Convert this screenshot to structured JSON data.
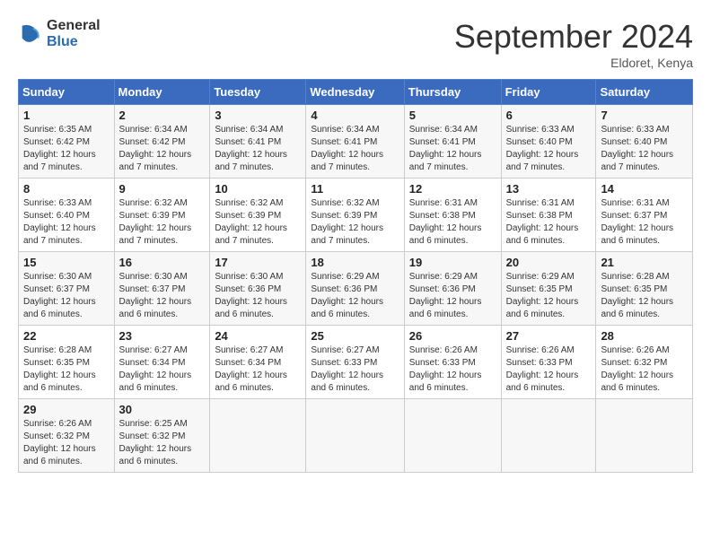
{
  "logo": {
    "general": "General",
    "blue": "Blue"
  },
  "title": "September 2024",
  "location": "Eldoret, Kenya",
  "days_of_week": [
    "Sunday",
    "Monday",
    "Tuesday",
    "Wednesday",
    "Thursday",
    "Friday",
    "Saturday"
  ],
  "weeks": [
    [
      {
        "day": "1",
        "sunrise": "6:35 AM",
        "sunset": "6:42 PM",
        "daylight": "12 hours and 7 minutes."
      },
      {
        "day": "2",
        "sunrise": "6:34 AM",
        "sunset": "6:42 PM",
        "daylight": "12 hours and 7 minutes."
      },
      {
        "day": "3",
        "sunrise": "6:34 AM",
        "sunset": "6:41 PM",
        "daylight": "12 hours and 7 minutes."
      },
      {
        "day": "4",
        "sunrise": "6:34 AM",
        "sunset": "6:41 PM",
        "daylight": "12 hours and 7 minutes."
      },
      {
        "day": "5",
        "sunrise": "6:34 AM",
        "sunset": "6:41 PM",
        "daylight": "12 hours and 7 minutes."
      },
      {
        "day": "6",
        "sunrise": "6:33 AM",
        "sunset": "6:40 PM",
        "daylight": "12 hours and 7 minutes."
      },
      {
        "day": "7",
        "sunrise": "6:33 AM",
        "sunset": "6:40 PM",
        "daylight": "12 hours and 7 minutes."
      }
    ],
    [
      {
        "day": "8",
        "sunrise": "6:33 AM",
        "sunset": "6:40 PM",
        "daylight": "12 hours and 7 minutes."
      },
      {
        "day": "9",
        "sunrise": "6:32 AM",
        "sunset": "6:39 PM",
        "daylight": "12 hours and 7 minutes."
      },
      {
        "day": "10",
        "sunrise": "6:32 AM",
        "sunset": "6:39 PM",
        "daylight": "12 hours and 7 minutes."
      },
      {
        "day": "11",
        "sunrise": "6:32 AM",
        "sunset": "6:39 PM",
        "daylight": "12 hours and 7 minutes."
      },
      {
        "day": "12",
        "sunrise": "6:31 AM",
        "sunset": "6:38 PM",
        "daylight": "12 hours and 6 minutes."
      },
      {
        "day": "13",
        "sunrise": "6:31 AM",
        "sunset": "6:38 PM",
        "daylight": "12 hours and 6 minutes."
      },
      {
        "day": "14",
        "sunrise": "6:31 AM",
        "sunset": "6:37 PM",
        "daylight": "12 hours and 6 minutes."
      }
    ],
    [
      {
        "day": "15",
        "sunrise": "6:30 AM",
        "sunset": "6:37 PM",
        "daylight": "12 hours and 6 minutes."
      },
      {
        "day": "16",
        "sunrise": "6:30 AM",
        "sunset": "6:37 PM",
        "daylight": "12 hours and 6 minutes."
      },
      {
        "day": "17",
        "sunrise": "6:30 AM",
        "sunset": "6:36 PM",
        "daylight": "12 hours and 6 minutes."
      },
      {
        "day": "18",
        "sunrise": "6:29 AM",
        "sunset": "6:36 PM",
        "daylight": "12 hours and 6 minutes."
      },
      {
        "day": "19",
        "sunrise": "6:29 AM",
        "sunset": "6:36 PM",
        "daylight": "12 hours and 6 minutes."
      },
      {
        "day": "20",
        "sunrise": "6:29 AM",
        "sunset": "6:35 PM",
        "daylight": "12 hours and 6 minutes."
      },
      {
        "day": "21",
        "sunrise": "6:28 AM",
        "sunset": "6:35 PM",
        "daylight": "12 hours and 6 minutes."
      }
    ],
    [
      {
        "day": "22",
        "sunrise": "6:28 AM",
        "sunset": "6:35 PM",
        "daylight": "12 hours and 6 minutes."
      },
      {
        "day": "23",
        "sunrise": "6:27 AM",
        "sunset": "6:34 PM",
        "daylight": "12 hours and 6 minutes."
      },
      {
        "day": "24",
        "sunrise": "6:27 AM",
        "sunset": "6:34 PM",
        "daylight": "12 hours and 6 minutes."
      },
      {
        "day": "25",
        "sunrise": "6:27 AM",
        "sunset": "6:33 PM",
        "daylight": "12 hours and 6 minutes."
      },
      {
        "day": "26",
        "sunrise": "6:26 AM",
        "sunset": "6:33 PM",
        "daylight": "12 hours and 6 minutes."
      },
      {
        "day": "27",
        "sunrise": "6:26 AM",
        "sunset": "6:33 PM",
        "daylight": "12 hours and 6 minutes."
      },
      {
        "day": "28",
        "sunrise": "6:26 AM",
        "sunset": "6:32 PM",
        "daylight": "12 hours and 6 minutes."
      }
    ],
    [
      {
        "day": "29",
        "sunrise": "6:26 AM",
        "sunset": "6:32 PM",
        "daylight": "12 hours and 6 minutes."
      },
      {
        "day": "30",
        "sunrise": "6:25 AM",
        "sunset": "6:32 PM",
        "daylight": "12 hours and 6 minutes."
      },
      null,
      null,
      null,
      null,
      null
    ]
  ],
  "labels": {
    "sunrise": "Sunrise:",
    "sunset": "Sunset:",
    "daylight": "Daylight:"
  }
}
